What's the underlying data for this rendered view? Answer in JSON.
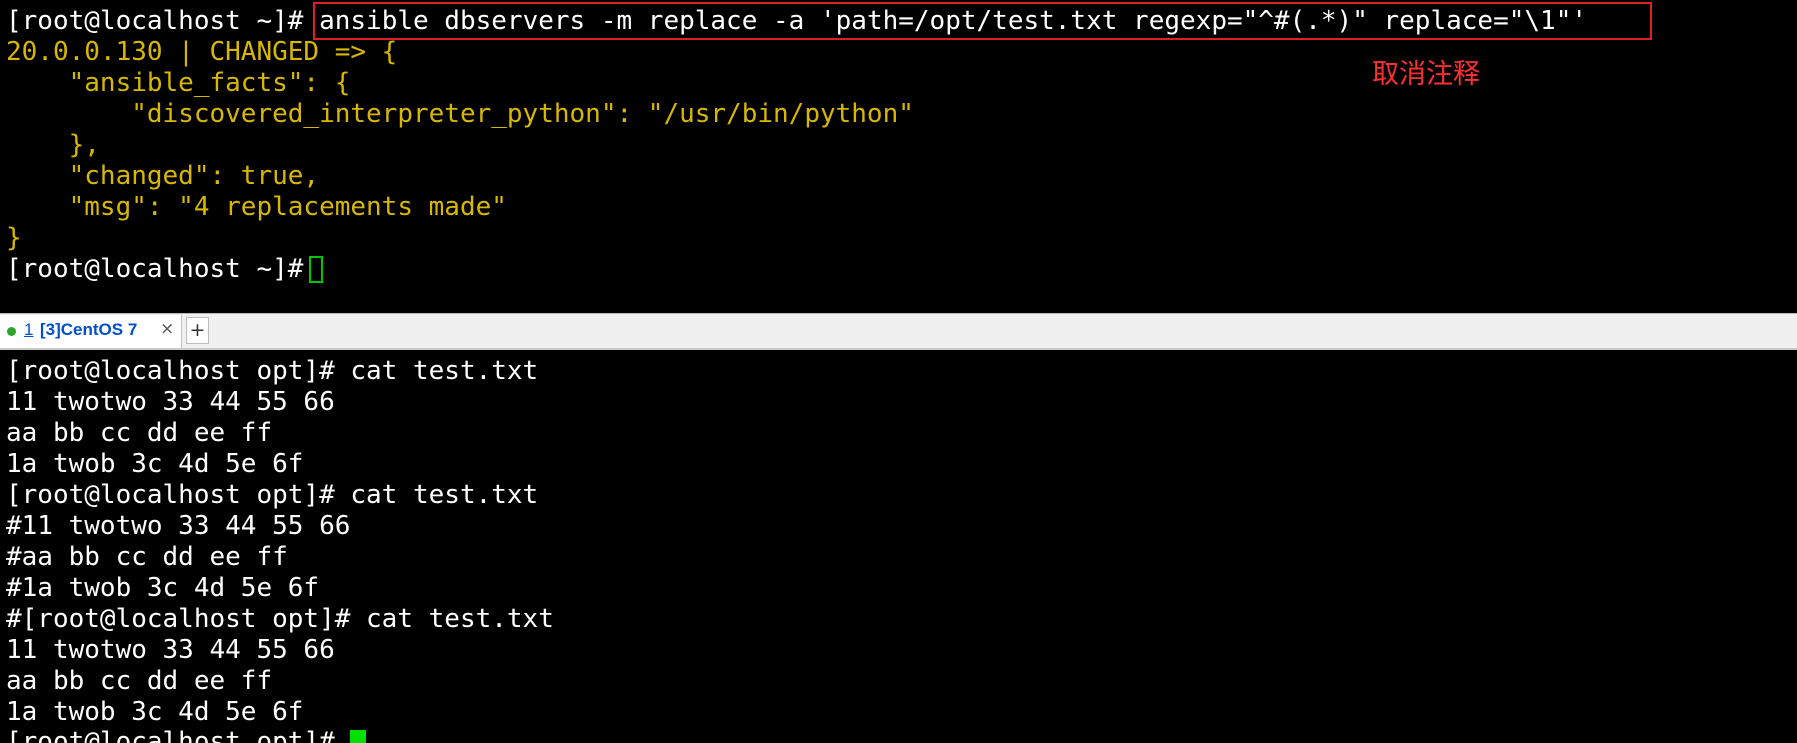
{
  "top_terminal": {
    "prompt": "[root@localhost ~]#",
    "command": " ansible dbservers -m replace -a 'path=/opt/test.txt regexp=\"^#(.*)\" replace=\"\\1\"'",
    "output": [
      "20.0.0.130 | CHANGED => {",
      "    \"ansible_facts\": {",
      "        \"discovered_interpreter_python\": \"/usr/bin/python\"",
      "    },",
      "    \"changed\": true,",
      "    \"msg\": \"4 replacements made\"",
      "}"
    ],
    "final_prompt": "[root@localhost ~]#"
  },
  "annotation": {
    "text": "取消注释",
    "color": "#ff3030"
  },
  "tabbar": {
    "tab": {
      "number": "1",
      "title": "[3]CentOS 7",
      "close": "×",
      "status_color": "#2aa52a"
    },
    "add_label": "+"
  },
  "bottom_terminal": {
    "lines": [
      "[root@localhost opt]# cat test.txt",
      "11 twotwo 33 44 55 66",
      "aa bb cc dd ee ff",
      "1a twob 3c 4d 5e 6f",
      "[root@localhost opt]# cat test.txt",
      "#11 twotwo 33 44 55 66",
      "#aa bb cc dd ee ff",
      "#1a twob 3c 4d 5e 6f",
      "#[root@localhost opt]# cat test.txt",
      "11 twotwo 33 44 55 66",
      "aa bb cc dd ee ff",
      "1a twob 3c 4d 5e 6f"
    ],
    "final_prompt": "[root@localhost opt]#"
  },
  "colors": {
    "terminal_bg": "#000000",
    "text": "#ffffff",
    "output_yellow": "#d7b700",
    "cursor_green": "#00e000",
    "highlight_red": "#e02020"
  }
}
